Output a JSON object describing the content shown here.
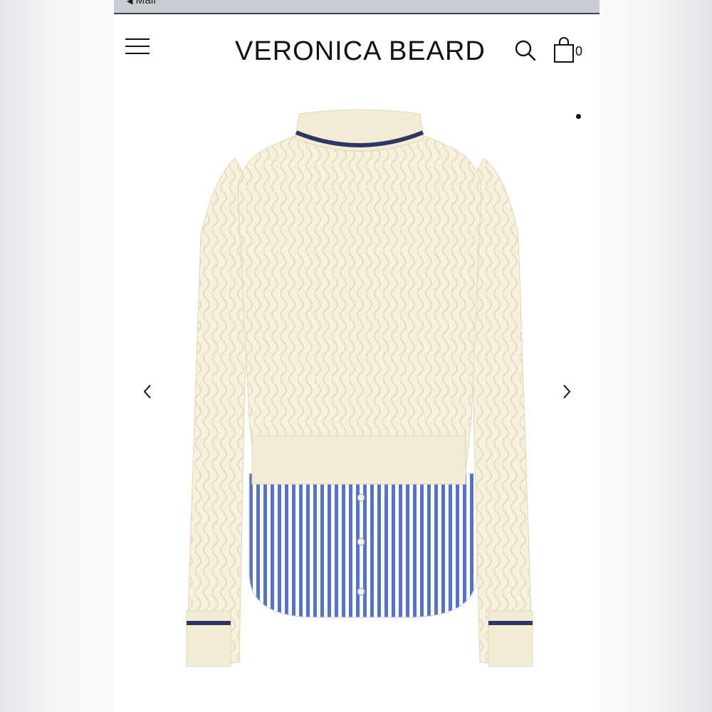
{
  "status_bar": {
    "back_label": "Mail",
    "back_icon": "back-arrow-icon"
  },
  "header": {
    "brand": "VERONICA BEARD",
    "menu_icon": "hamburger-menu-icon",
    "search_icon": "search-icon",
    "cart_icon": "shopping-bag-icon",
    "cart_count": "0"
  },
  "gallery": {
    "product_image": "cream cable knit sweater with navy tipping and blue striped shirt hem",
    "prev_icon": "chevron-left-icon",
    "next_icon": "chevron-right-icon",
    "colors": {
      "sweater": "#f6f0dc",
      "tipping": "#2f3565",
      "stripe": "#5b73b8"
    }
  }
}
